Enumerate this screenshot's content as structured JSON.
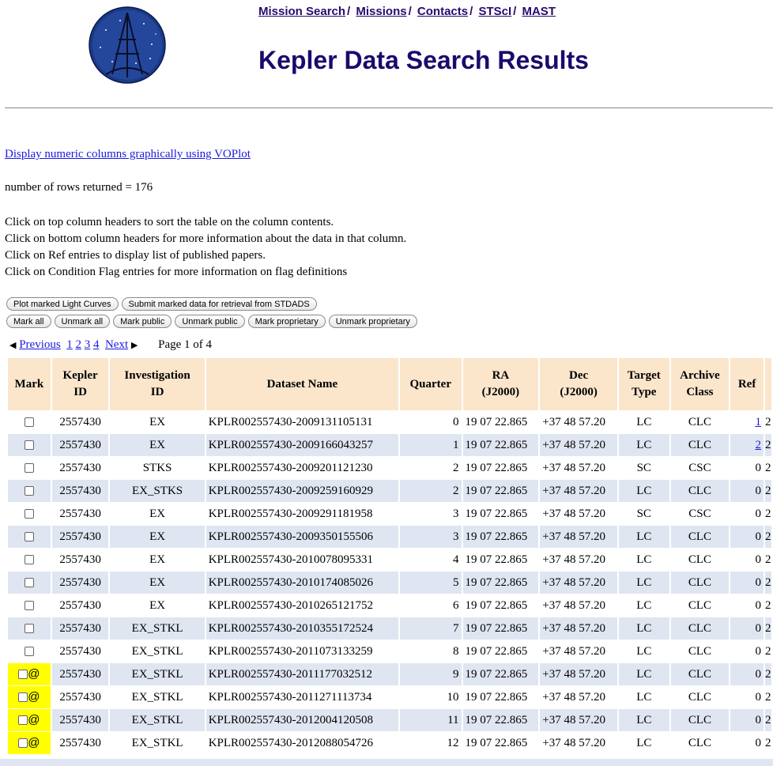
{
  "nav": {
    "links": [
      "Mission Search",
      "Missions",
      "Contacts",
      "STScI",
      "MAST"
    ],
    "separator": "/"
  },
  "title": "Kepler Data Search Results",
  "voplot_link": "Display numeric columns graphically using VOPlot",
  "rows_returned": "number of rows returned = 176",
  "instructions": [
    "Click on top column headers to sort the table on the column contents.",
    "Click on bottom column headers for more information about the data in that column.",
    "Click on Ref entries to display list of published papers.",
    "Click on Condition Flag entries for more information on flag definitions"
  ],
  "buttons_row1": [
    "Plot marked Light Curves",
    "Submit marked data for retrieval from STDADS"
  ],
  "buttons_row2": [
    "Mark all",
    "Unmark all",
    "Mark public",
    "Unmark public",
    "Mark proprietary",
    "Unmark proprietary"
  ],
  "pager": {
    "previous": "Previous",
    "pages": [
      "1",
      "2",
      "3",
      "4"
    ],
    "next": "Next",
    "page_info": "Page 1 of 4"
  },
  "table": {
    "headers": [
      [
        "Mark"
      ],
      [
        "Kepler",
        "ID"
      ],
      [
        "Investigation",
        "ID"
      ],
      [
        "Dataset Name"
      ],
      [
        "Quarter"
      ],
      [
        "RA",
        "(J2000)"
      ],
      [
        "Dec",
        "(J2000)"
      ],
      [
        "Target",
        "Type"
      ],
      [
        "Archive",
        "Class"
      ],
      [
        "Ref"
      ]
    ],
    "rows": [
      {
        "marked": false,
        "kepler_id": "2557430",
        "inv_id": "EX",
        "dataset": "KPLR002557430-2009131105131",
        "quarter": "0",
        "ra": "19 07 22.865",
        "dec": "+37 48 57.20",
        "target": "LC",
        "archive": "CLC",
        "ref": "1",
        "ref_link": true,
        "extra": "2"
      },
      {
        "marked": false,
        "kepler_id": "2557430",
        "inv_id": "EX",
        "dataset": "KPLR002557430-2009166043257",
        "quarter": "1",
        "ra": "19 07 22.865",
        "dec": "+37 48 57.20",
        "target": "LC",
        "archive": "CLC",
        "ref": "2",
        "ref_link": true,
        "extra": "2"
      },
      {
        "marked": false,
        "kepler_id": "2557430",
        "inv_id": "STKS",
        "dataset": "KPLR002557430-2009201121230",
        "quarter": "2",
        "ra": "19 07 22.865",
        "dec": "+37 48 57.20",
        "target": "SC",
        "archive": "CSC",
        "ref": "0",
        "ref_link": false,
        "extra": "2"
      },
      {
        "marked": false,
        "kepler_id": "2557430",
        "inv_id": "EX_STKS",
        "dataset": "KPLR002557430-2009259160929",
        "quarter": "2",
        "ra": "19 07 22.865",
        "dec": "+37 48 57.20",
        "target": "LC",
        "archive": "CLC",
        "ref": "0",
        "ref_link": false,
        "extra": "2"
      },
      {
        "marked": false,
        "kepler_id": "2557430",
        "inv_id": "EX",
        "dataset": "KPLR002557430-2009291181958",
        "quarter": "3",
        "ra": "19 07 22.865",
        "dec": "+37 48 57.20",
        "target": "SC",
        "archive": "CSC",
        "ref": "0",
        "ref_link": false,
        "extra": "2"
      },
      {
        "marked": false,
        "kepler_id": "2557430",
        "inv_id": "EX",
        "dataset": "KPLR002557430-2009350155506",
        "quarter": "3",
        "ra": "19 07 22.865",
        "dec": "+37 48 57.20",
        "target": "LC",
        "archive": "CLC",
        "ref": "0",
        "ref_link": false,
        "extra": "2"
      },
      {
        "marked": false,
        "kepler_id": "2557430",
        "inv_id": "EX",
        "dataset": "KPLR002557430-2010078095331",
        "quarter": "4",
        "ra": "19 07 22.865",
        "dec": "+37 48 57.20",
        "target": "LC",
        "archive": "CLC",
        "ref": "0",
        "ref_link": false,
        "extra": "2"
      },
      {
        "marked": false,
        "kepler_id": "2557430",
        "inv_id": "EX",
        "dataset": "KPLR002557430-2010174085026",
        "quarter": "5",
        "ra": "19 07 22.865",
        "dec": "+37 48 57.20",
        "target": "LC",
        "archive": "CLC",
        "ref": "0",
        "ref_link": false,
        "extra": "2"
      },
      {
        "marked": false,
        "kepler_id": "2557430",
        "inv_id": "EX",
        "dataset": "KPLR002557430-2010265121752",
        "quarter": "6",
        "ra": "19 07 22.865",
        "dec": "+37 48 57.20",
        "target": "LC",
        "archive": "CLC",
        "ref": "0",
        "ref_link": false,
        "extra": "2"
      },
      {
        "marked": false,
        "kepler_id": "2557430",
        "inv_id": "EX_STKL",
        "dataset": "KPLR002557430-2010355172524",
        "quarter": "7",
        "ra": "19 07 22.865",
        "dec": "+37 48 57.20",
        "target": "LC",
        "archive": "CLC",
        "ref": "0",
        "ref_link": false,
        "extra": "2"
      },
      {
        "marked": false,
        "kepler_id": "2557430",
        "inv_id": "EX_STKL",
        "dataset": "KPLR002557430-2011073133259",
        "quarter": "8",
        "ra": "19 07 22.865",
        "dec": "+37 48 57.20",
        "target": "LC",
        "archive": "CLC",
        "ref": "0",
        "ref_link": false,
        "extra": "2"
      },
      {
        "marked": true,
        "kepler_id": "2557430",
        "inv_id": "EX_STKL",
        "dataset": "KPLR002557430-2011177032512",
        "quarter": "9",
        "ra": "19 07 22.865",
        "dec": "+37 48 57.20",
        "target": "LC",
        "archive": "CLC",
        "ref": "0",
        "ref_link": false,
        "extra": "2"
      },
      {
        "marked": true,
        "kepler_id": "2557430",
        "inv_id": "EX_STKL",
        "dataset": "KPLR002557430-2011271113734",
        "quarter": "10",
        "ra": "19 07 22.865",
        "dec": "+37 48 57.20",
        "target": "LC",
        "archive": "CLC",
        "ref": "0",
        "ref_link": false,
        "extra": "2"
      },
      {
        "marked": true,
        "kepler_id": "2557430",
        "inv_id": "EX_STKL",
        "dataset": "KPLR002557430-2012004120508",
        "quarter": "11",
        "ra": "19 07 22.865",
        "dec": "+37 48 57.20",
        "target": "LC",
        "archive": "CLC",
        "ref": "0",
        "ref_link": false,
        "extra": "2"
      },
      {
        "marked": true,
        "kepler_id": "2557430",
        "inv_id": "EX_STKL",
        "dataset": "KPLR002557430-2012088054726",
        "quarter": "12",
        "ra": "19 07 22.865",
        "dec": "+37 48 57.20",
        "target": "LC",
        "archive": "CLC",
        "ref": "0",
        "ref_link": false,
        "extra": "2"
      }
    ],
    "marked_symbol": "@"
  },
  "colors": {
    "title": "#1a0a6e",
    "header_bg": "#fbe6cc",
    "row_alt_bg": "#dfe6f1",
    "highlight": "#ffff00",
    "link": "#1a1ae0"
  }
}
